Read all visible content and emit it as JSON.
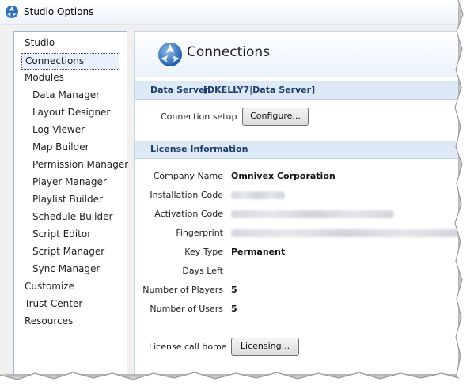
{
  "window": {
    "title": "Studio Options"
  },
  "nav": {
    "items": [
      {
        "label": "Studio",
        "level": 1
      },
      {
        "label": "Connections",
        "level": 1,
        "selected": true
      },
      {
        "label": "Modules",
        "level": 1
      },
      {
        "label": "Data Manager",
        "level": 2
      },
      {
        "label": "Layout Designer",
        "level": 2
      },
      {
        "label": "Log Viewer",
        "level": 2
      },
      {
        "label": "Map Builder",
        "level": 2
      },
      {
        "label": "Permission Manager",
        "level": 2
      },
      {
        "label": "Player Manager",
        "level": 2
      },
      {
        "label": "Playlist Builder",
        "level": 2
      },
      {
        "label": "Schedule Builder",
        "level": 2
      },
      {
        "label": "Script Editor",
        "level": 2
      },
      {
        "label": "Script Manager",
        "level": 2
      },
      {
        "label": "Sync Manager",
        "level": 2
      },
      {
        "label": "Customize",
        "level": 1
      },
      {
        "label": "Trust Center",
        "level": 1
      },
      {
        "label": "Resources",
        "level": 1
      }
    ]
  },
  "main": {
    "title": "Connections",
    "data_server": {
      "label": "Data Server",
      "value": "[DKELLY7|Data Server]",
      "connection_setup_label": "Connection setup",
      "configure_button": "Configure..."
    },
    "license": {
      "section_label": "License Information",
      "fields": {
        "company_name_label": "Company Name",
        "company_name_value": "Omnivex Corporation",
        "installation_code_label": "Installation Code",
        "activation_code_label": "Activation Code",
        "fingerprint_label": "Fingerprint",
        "key_type_label": "Key Type",
        "key_type_value": "Permanent",
        "days_left_label": "Days Left",
        "players_label": "Number of Players",
        "players_value": "5",
        "users_label": "Number of Users",
        "users_value": "5"
      },
      "call_home_label": "License call home",
      "licensing_button": "Licensing..."
    }
  },
  "colors": {
    "accent_border": "#9fb4cf",
    "section_bar": "#dde9f7",
    "section_text": "#1f3d6b"
  }
}
